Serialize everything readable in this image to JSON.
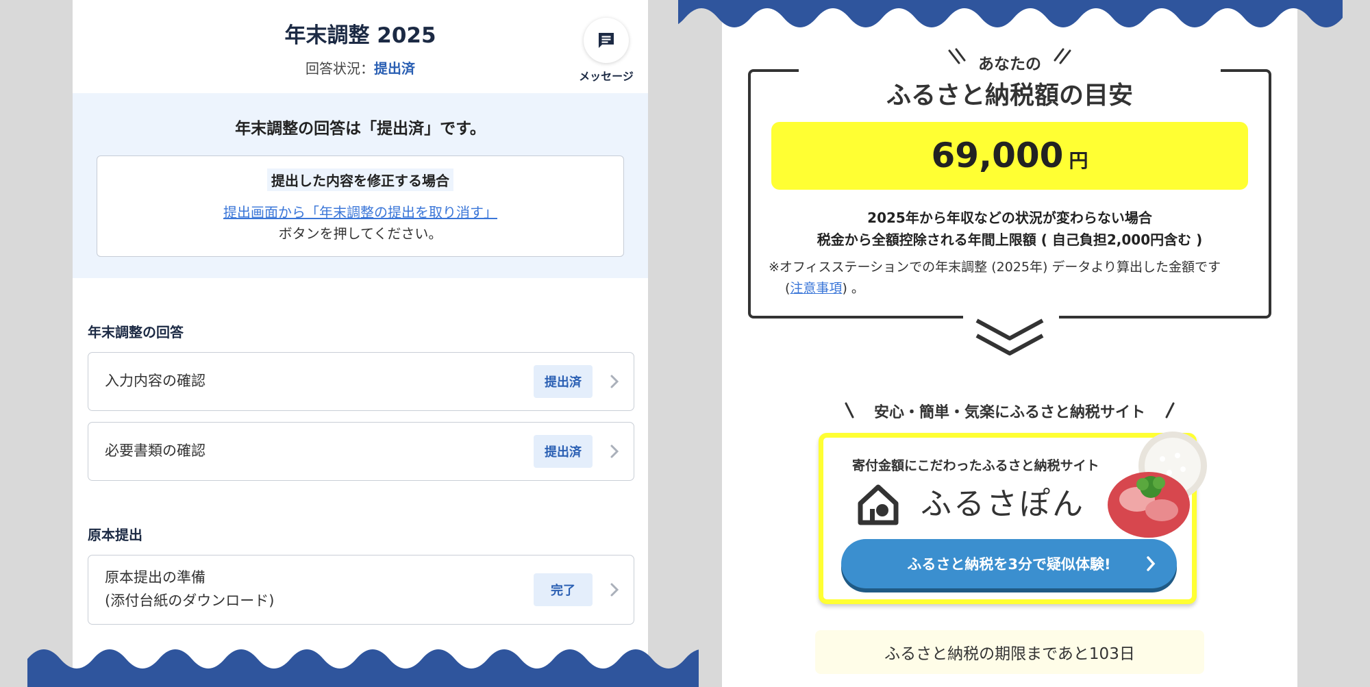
{
  "left": {
    "header": {
      "title": "年末調整 2025",
      "status_label": "回答状況：",
      "status_value": "提出済",
      "message_label": "メッセージ"
    },
    "notice": {
      "heading": "年末調整の回答は「提出済」です。",
      "box_title": "提出した内容を修正する場合",
      "link_text": "提出画面から「年末調整の提出を取り消す」",
      "tail_text": "ボタンを押してください。"
    },
    "sections": [
      {
        "heading": "年末調整の回答",
        "rows": [
          {
            "label": "入力内容の確認",
            "badge": "提出済"
          },
          {
            "label": "必要書類の確認",
            "badge": "提出済"
          }
        ]
      },
      {
        "heading": "原本提出",
        "rows": [
          {
            "label_line1": "原本提出の準備",
            "label_line2": "(添付台紙のダウンロード)",
            "badge": "完了"
          }
        ]
      }
    ]
  },
  "right": {
    "estimate": {
      "pre_title": "あなたの",
      "title": "ふるさと納税額の目安",
      "amount": "69,000",
      "unit": "円",
      "condition_1": "2025年から年収などの状況が変わらない場合",
      "condition_2": "税金から全額控除される年間上限額 ( 自己負担2,000円含む )",
      "note_1": "※オフィスステーションでの年末調整 (2025年) データより算出した金額です",
      "note_2_prefix": "(",
      "note_2_link": "注意事項",
      "note_2_suffix": ") 。"
    },
    "promo": {
      "tagline": "安心・簡単・気楽にふるさと納税サイト",
      "subtitle": "寄付金額にこだわったふるさと納税サイト",
      "brand": "ふるさぽん",
      "cta": "ふるさと納税を3分で疑似体験!"
    },
    "deadline": "ふるさと納税の期限まであと103日"
  },
  "colors": {
    "navy_wave": "#2f559d",
    "accent_blue": "#2a5fb3",
    "highlight_yellow": "#ffff33",
    "cta_blue": "#3b8fcf",
    "notice_bg": "#edf4fd"
  }
}
